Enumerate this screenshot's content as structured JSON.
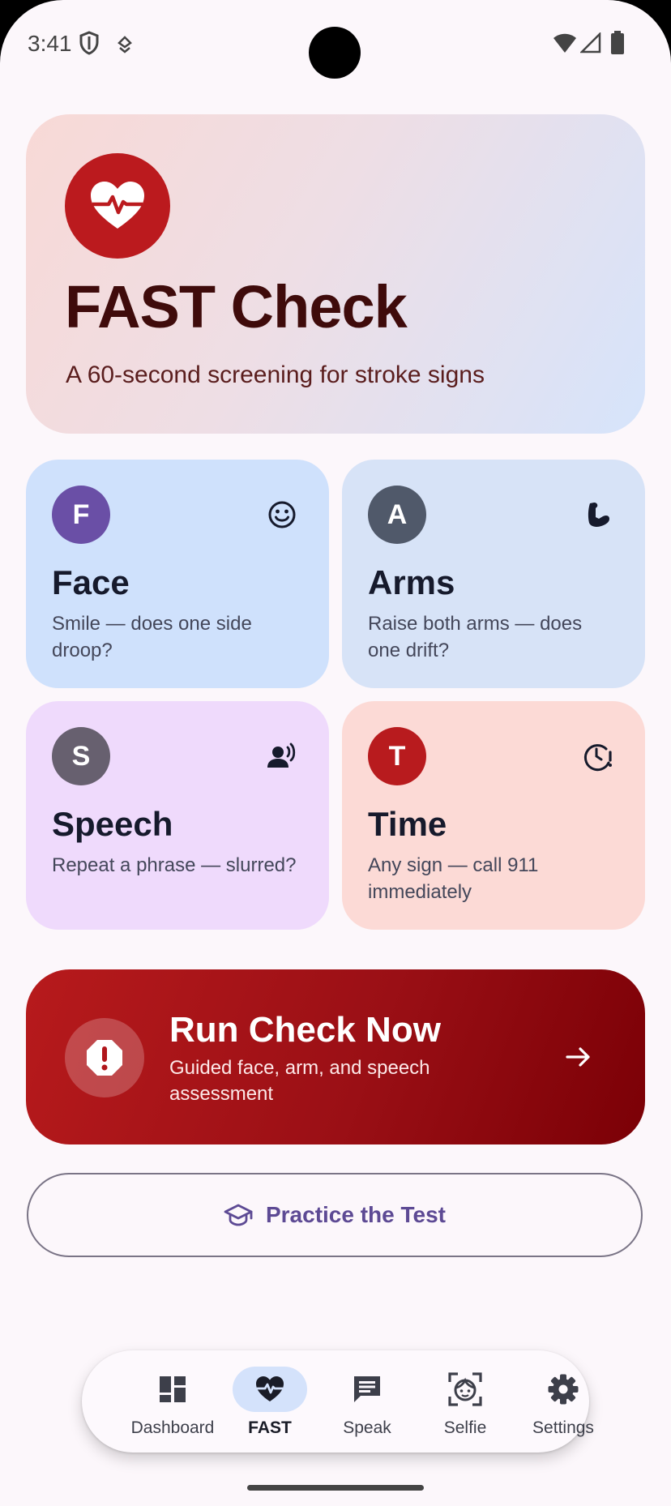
{
  "status_bar": {
    "time": "3:41"
  },
  "hero": {
    "title": "FAST Check",
    "subtitle": "A 60-second screening for stroke signs"
  },
  "cards": [
    {
      "letter": "F",
      "title": "Face",
      "desc": "Smile — does one side droop?",
      "icon": "smile-icon",
      "color": "#6a4fa6",
      "bg": "#cfe1fc"
    },
    {
      "letter": "A",
      "title": "Arms",
      "desc": "Raise both arms — does one drift?",
      "icon": "arm-icon",
      "color": "#50596a",
      "bg": "#d7e3f7"
    },
    {
      "letter": "S",
      "title": "Speech",
      "desc": "Repeat a phrase — slurred?",
      "icon": "speaking-person-icon",
      "color": "#67606f",
      "bg": "#efdafc"
    },
    {
      "letter": "T",
      "title": "Time",
      "desc": "Any sign — call 911 immediately",
      "icon": "clock-alert-icon",
      "color": "#b81b1e",
      "bg": "#fcdad6"
    }
  ],
  "run_check": {
    "title": "Run Check Now",
    "subtitle": "Guided face, arm, and speech assessment"
  },
  "practice": {
    "label": "Practice the Test"
  },
  "nav": {
    "items": [
      {
        "label": "Dashboard",
        "icon": "dashboard-icon"
      },
      {
        "label": "FAST",
        "icon": "heart-pulse-icon",
        "active": true
      },
      {
        "label": "Speak",
        "icon": "chat-icon"
      },
      {
        "label": "Selfie",
        "icon": "face-scan-icon"
      },
      {
        "label": "Settings",
        "icon": "gear-icon"
      }
    ]
  },
  "colors": {
    "accent": "#bb1a1e",
    "primary_text": "#3f0b0b",
    "purple_accent": "#5d4a94"
  }
}
